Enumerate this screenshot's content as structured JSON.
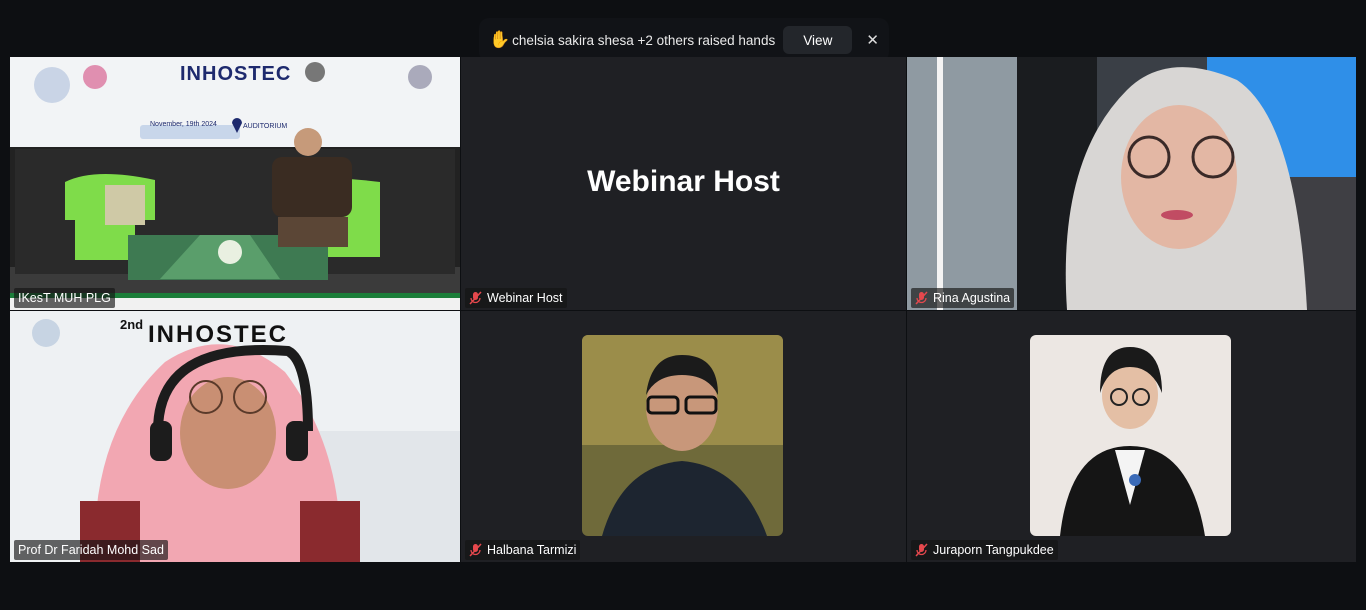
{
  "notification": {
    "icon": "raised-hand-icon",
    "message": "chelsia sakira shesa +2 others raised hands",
    "view_label": "View",
    "close_label": "✕"
  },
  "tiles": {
    "ikest": {
      "name": "IKesT MUH PLG",
      "banner_logo_text": "INHOSTEC",
      "date_text": "November, 19th 2024",
      "venue_text": "AUDITORIUM"
    },
    "host": {
      "center_title": "Webinar Host",
      "name": "Webinar Host"
    },
    "rina": {
      "name": "Rina Agustina"
    },
    "faridah": {
      "name": "Prof Dr Faridah Mohd Sad",
      "bg_text_2nd": "2nd",
      "bg_text_logo": "INHOSTEC"
    },
    "halbana": {
      "name": "Halbana Tarmizi"
    },
    "juraporn": {
      "name": "Juraporn Tangpukdee"
    }
  },
  "colors": {
    "active_speaker": "#49d65c",
    "mic_muted": "#e5484d"
  }
}
